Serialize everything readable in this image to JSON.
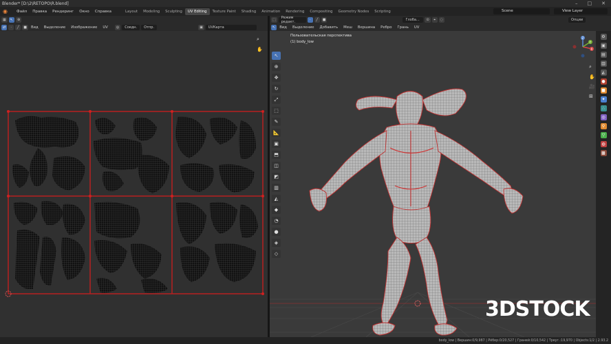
{
  "window": {
    "title": "Blender* [D:\\2\\RETOPO\\R.blend]"
  },
  "menu": [
    "Файл",
    "Правка",
    "Рендеринг",
    "Окно",
    "Справка"
  ],
  "workspaces": [
    {
      "label": "Layout",
      "active": false
    },
    {
      "label": "Modeling",
      "active": false
    },
    {
      "label": "Sculpting",
      "active": false
    },
    {
      "label": "UV Editing",
      "active": true
    },
    {
      "label": "Texture Paint",
      "active": false
    },
    {
      "label": "Shading",
      "active": false
    },
    {
      "label": "Animation",
      "active": false
    },
    {
      "label": "Rendering",
      "active": false
    },
    {
      "label": "Compositing",
      "active": false
    },
    {
      "label": "Geometry Nodes",
      "active": false
    },
    {
      "label": "Scripting",
      "active": false
    }
  ],
  "scene": {
    "label": "Scene",
    "view_layer": "View Layer"
  },
  "uv_editor": {
    "menu": [
      "Вид",
      "Выделение",
      "Изображение",
      "UV"
    ],
    "sync_label": "Соедн.",
    "snap_label": "Отпр.",
    "uvmap_label": "UVКарта"
  },
  "viewport3d": {
    "mode": "Режим редакт.",
    "menu": [
      "Вид",
      "Выделение",
      "Добавить",
      "Меш",
      "Вершина",
      "Ребро",
      "Грань",
      "UV"
    ],
    "orientation": "Глоба...",
    "options": "Опции",
    "perspective_label": "Пользовательская перспектива",
    "object_label": "(1) body_low"
  },
  "gizmo": {
    "x": "X",
    "y": "Y",
    "z": "Z"
  },
  "status": {
    "text": "body_low | Вершин:0/9,987 | Рёбер:0/20,527 | Граней:0/10,542 | Треуг.:19,970 | Objects:1/2 | 2.93.2"
  },
  "watermark": {
    "text_a": "3D",
    "text_b": "STOCK"
  }
}
